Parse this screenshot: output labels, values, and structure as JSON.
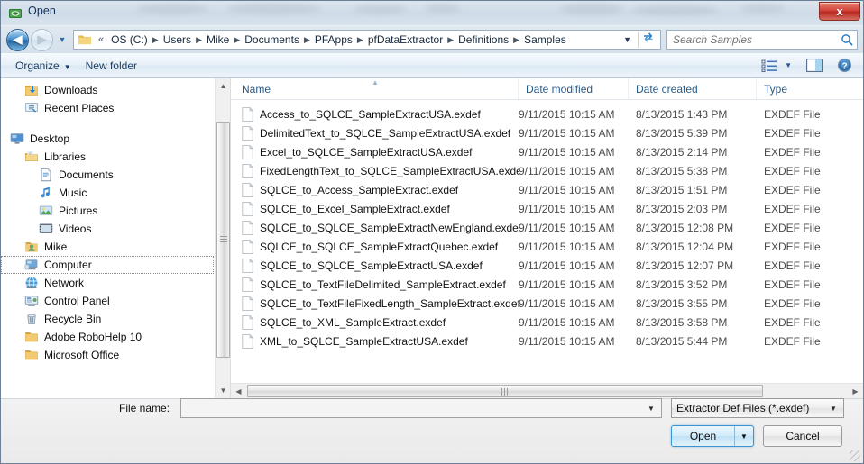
{
  "window": {
    "title": "Open",
    "icon": "app-window-icon",
    "close_label": "x"
  },
  "nav": {
    "back_icon": "back-arrow-icon",
    "back_glyph": "◀",
    "forward_icon": "forward-arrow-icon",
    "forward_glyph": "▶",
    "history_caret": "▼",
    "breadcrumb_root": "«",
    "breadcrumb": [
      "OS (C:)",
      "Users",
      "Mike",
      "Documents",
      "PFApps",
      "pfDataExtractor",
      "Definitions",
      "Samples"
    ],
    "separator": "▶",
    "dropdown_caret": "▼",
    "refresh_icon": "refresh-icon"
  },
  "search": {
    "placeholder": "Search Samples",
    "value": "",
    "icon": "search-icon"
  },
  "command_bar": {
    "organize": "Organize",
    "organize_caret": "▼",
    "new_folder": "New folder",
    "view_icon": "change-view-icon",
    "view_caret": "▼",
    "preview_icon": "preview-pane-icon",
    "help_icon": "help-icon"
  },
  "sidebar": {
    "items": [
      {
        "label": "Downloads",
        "icon": "downloads-folder-icon",
        "indent": 1,
        "focused": false,
        "gap_before": false
      },
      {
        "label": "Recent Places",
        "icon": "recent-places-icon",
        "indent": 1,
        "focused": false,
        "gap_before": false
      },
      {
        "label": "Desktop",
        "icon": "desktop-icon",
        "indent": 0,
        "focused": false,
        "gap_before": true
      },
      {
        "label": "Libraries",
        "icon": "libraries-icon",
        "indent": 1,
        "focused": false,
        "gap_before": false
      },
      {
        "label": "Documents",
        "icon": "documents-library-icon",
        "indent": 2,
        "focused": false,
        "gap_before": false
      },
      {
        "label": "Music",
        "icon": "music-library-icon",
        "indent": 2,
        "focused": false,
        "gap_before": false
      },
      {
        "label": "Pictures",
        "icon": "pictures-library-icon",
        "indent": 2,
        "focused": false,
        "gap_before": false
      },
      {
        "label": "Videos",
        "icon": "videos-library-icon",
        "indent": 2,
        "focused": false,
        "gap_before": false
      },
      {
        "label": "Mike",
        "icon": "user-folder-icon",
        "indent": 1,
        "focused": false,
        "gap_before": false
      },
      {
        "label": "Computer",
        "icon": "computer-icon",
        "indent": 1,
        "focused": true,
        "gap_before": false
      },
      {
        "label": "Network",
        "icon": "network-icon",
        "indent": 1,
        "focused": false,
        "gap_before": false
      },
      {
        "label": "Control Panel",
        "icon": "control-panel-icon",
        "indent": 1,
        "focused": false,
        "gap_before": false
      },
      {
        "label": "Recycle Bin",
        "icon": "recycle-bin-icon",
        "indent": 1,
        "focused": false,
        "gap_before": false
      },
      {
        "label": "Adobe RoboHelp 10",
        "icon": "folder-icon",
        "indent": 1,
        "focused": false,
        "gap_before": false
      },
      {
        "label": "Microsoft Office",
        "icon": "folder-icon",
        "indent": 1,
        "focused": false,
        "gap_before": false
      }
    ],
    "scroll_up_glyph": "▲",
    "scroll_down_glyph": "▼"
  },
  "file_list": {
    "columns": [
      "Name",
      "Date modified",
      "Date created",
      "Type"
    ],
    "sort_indicator": "▲",
    "sort_column": "Name",
    "rows": [
      {
        "name": "Access_to_SQLCE_SampleExtractUSA.exdef",
        "modified": "9/11/2015 10:15 AM",
        "created": "8/13/2015 1:43 PM",
        "type": "EXDEF File"
      },
      {
        "name": "DelimitedText_to_SQLCE_SampleExtractUSA.exdef",
        "modified": "9/11/2015 10:15 AM",
        "created": "8/13/2015 5:39 PM",
        "type": "EXDEF File"
      },
      {
        "name": "Excel_to_SQLCE_SampleExtractUSA.exdef",
        "modified": "9/11/2015 10:15 AM",
        "created": "8/13/2015 2:14 PM",
        "type": "EXDEF File"
      },
      {
        "name": "FixedLengthText_to_SQLCE_SampleExtractUSA.exdef",
        "modified": "9/11/2015 10:15 AM",
        "created": "8/13/2015 5:38 PM",
        "type": "EXDEF File"
      },
      {
        "name": "SQLCE_to_Access_SampleExtract.exdef",
        "modified": "9/11/2015 10:15 AM",
        "created": "8/13/2015 1:51 PM",
        "type": "EXDEF File"
      },
      {
        "name": "SQLCE_to_Excel_SampleExtract.exdef",
        "modified": "9/11/2015 10:15 AM",
        "created": "8/13/2015 2:03 PM",
        "type": "EXDEF File"
      },
      {
        "name": "SQLCE_to_SQLCE_SampleExtractNewEngland.exdef",
        "modified": "9/11/2015 10:15 AM",
        "created": "8/13/2015 12:08 PM",
        "type": "EXDEF File"
      },
      {
        "name": "SQLCE_to_SQLCE_SampleExtractQuebec.exdef",
        "modified": "9/11/2015 10:15 AM",
        "created": "8/13/2015 12:04 PM",
        "type": "EXDEF File"
      },
      {
        "name": "SQLCE_to_SQLCE_SampleExtractUSA.exdef",
        "modified": "9/11/2015 10:15 AM",
        "created": "8/13/2015 12:07 PM",
        "type": "EXDEF File"
      },
      {
        "name": "SQLCE_to_TextFileDelimited_SampleExtract.exdef",
        "modified": "9/11/2015 10:15 AM",
        "created": "8/13/2015 3:52 PM",
        "type": "EXDEF File"
      },
      {
        "name": "SQLCE_to_TextFileFixedLength_SampleExtract.exdef",
        "modified": "9/11/2015 10:15 AM",
        "created": "8/13/2015 3:55 PM",
        "type": "EXDEF File"
      },
      {
        "name": "SQLCE_to_XML_SampleExtract.exdef",
        "modified": "9/11/2015 10:15 AM",
        "created": "8/13/2015 3:58 PM",
        "type": "EXDEF File"
      },
      {
        "name": "XML_to_SQLCE_SampleExtractUSA.exdef",
        "modified": "9/11/2015 10:15 AM",
        "created": "8/13/2015 5:44 PM",
        "type": "EXDEF File"
      }
    ],
    "scroll_left_glyph": "◀",
    "scroll_right_glyph": "▶"
  },
  "footer": {
    "filename_label": "File name:",
    "filename_value": "",
    "filename_caret": "▼",
    "filter_value": "Extractor Def Files (*.exdef)",
    "filter_caret": "▼",
    "open_label": "Open",
    "open_caret": "▼",
    "cancel_label": "Cancel"
  },
  "colors": {
    "accent": "#3c94d0",
    "close_red": "#d2453a",
    "header_text": "#2b5a85",
    "title_text": "#14315c"
  }
}
